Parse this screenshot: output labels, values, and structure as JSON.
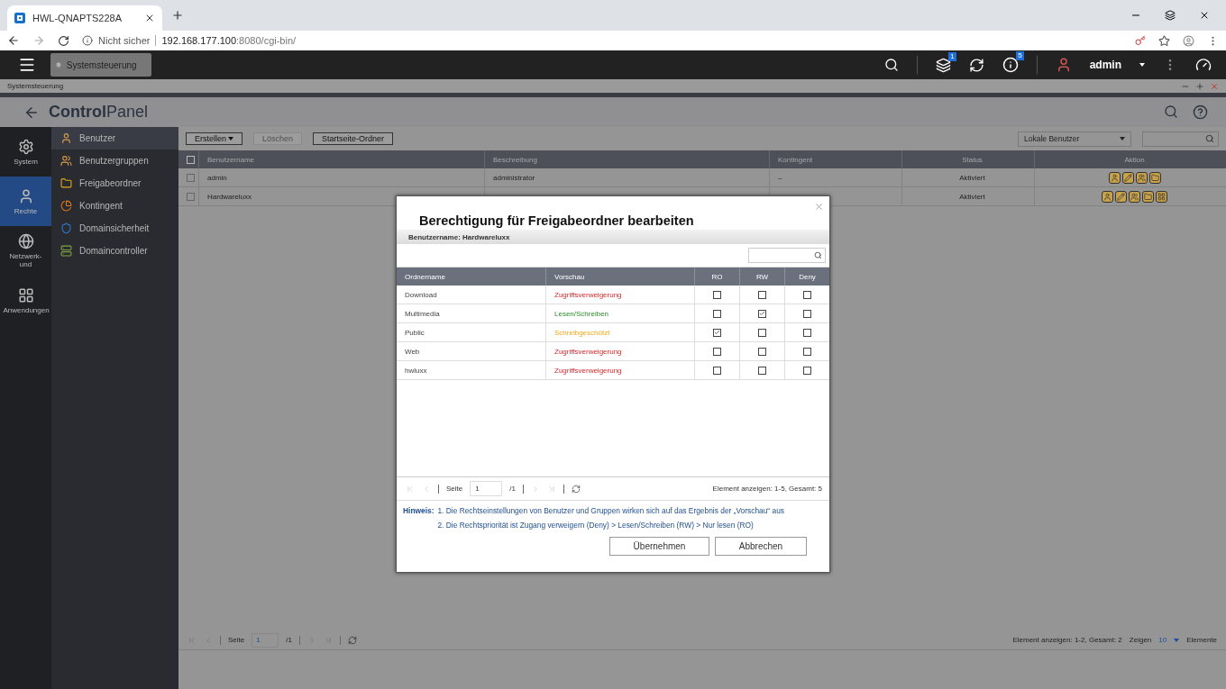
{
  "browser": {
    "tab_title": "HWL-QNAPTS228A",
    "security": "Nicht sicher",
    "host": "192.168.177.100",
    "path": ":8080/cgi-bin/"
  },
  "topbar": {
    "app_tab": "Systemsteuerung",
    "task_badge": "1",
    "info_badge": "5",
    "user": "admin"
  },
  "window_title": "Systemsteuerung",
  "header": {
    "title": "**Control**Panel"
  },
  "rail": [
    {
      "label": "System",
      "kind": "gear",
      "selected": false
    },
    {
      "label": "Rechte",
      "kind": "person",
      "selected": true
    },
    {
      "label": "Netzwerk- und",
      "kind": "globe",
      "selected": false
    },
    {
      "label": "Anwendungen",
      "kind": "apps",
      "selected": false
    }
  ],
  "submenu": [
    {
      "label": "Benutzer",
      "kind": "user",
      "selected": true
    },
    {
      "label": "Benutzergruppen",
      "kind": "group",
      "selected": false
    },
    {
      "label": "Freigabeordner",
      "kind": "folder",
      "selected": false
    },
    {
      "label": "Kontingent",
      "kind": "quota",
      "selected": false
    },
    {
      "label": "Domainsicherheit",
      "kind": "domain",
      "selected": false
    },
    {
      "label": "Domaincontroller",
      "kind": "controller",
      "selected": false
    }
  ],
  "toolbar": {
    "buttons": [
      {
        "label": "Erstellen",
        "dropdown": true,
        "disabled": false
      },
      {
        "label": "Löschen",
        "dropdown": false,
        "disabled": true
      },
      {
        "label": "Startseite-Ordner",
        "dropdown": false,
        "disabled": false
      }
    ],
    "filter": "Lokale Benutzer"
  },
  "table": {
    "columns": [
      "Benutzername",
      "Beschreibung",
      "Kontingent",
      "Status",
      "Aktion"
    ],
    "all_checked": false,
    "rows": [
      {
        "checked": false,
        "name": "admin",
        "description": "administrator",
        "quota": "–",
        "status": "Aktiviert",
        "actions": [
          {
            "kind": "info"
          },
          {
            "kind": "edit"
          },
          {
            "kind": "group"
          },
          {
            "kind": "folder"
          }
        ]
      },
      {
        "checked": false,
        "name": "Hardwareluxx",
        "status": "Aktiviert",
        "actions": [
          {
            "kind": "info"
          },
          {
            "kind": "edit"
          },
          {
            "kind": "group"
          },
          {
            "kind": "folder"
          },
          {
            "kind": "apps"
          }
        ]
      }
    ]
  },
  "pager": {
    "page_label": "Seite",
    "page": "1",
    "of": "/1",
    "summary": "Element anzeigen: 1-2, Gesamt: 2",
    "show_label": "Zeigen",
    "per_page": "10",
    "unit": "Elemente"
  },
  "dialog": {
    "title": "Berechtigung für Freigabeordner bearbeiten",
    "user_label": "Benutzername: Hardwareluxx",
    "columns": [
      "Ordnername",
      "Vorschau",
      "RO",
      "RW",
      "Deny"
    ],
    "rows": [
      {
        "name": "Download",
        "preview": "Zugriffsverweigerung",
        "kind": "deny",
        "ro": false,
        "rw": false,
        "deny": false
      },
      {
        "name": "Multimedia",
        "preview": "Lesen/Schreiben",
        "kind": "rw",
        "ro": false,
        "rw": true,
        "deny": false
      },
      {
        "name": "Public",
        "preview": "Schreibgeschützt",
        "kind": "ro",
        "ro": true,
        "rw": false,
        "deny": false
      },
      {
        "name": "Web",
        "preview": "Zugriffsverweigerung",
        "kind": "deny",
        "ro": false,
        "rw": false,
        "deny": false
      },
      {
        "name": "hwluxx",
        "preview": "Zugriffsverweigerung",
        "kind": "deny",
        "ro": false,
        "rw": false,
        "deny": false
      }
    ],
    "pager": {
      "page_label": "Seite",
      "page": "1",
      "of": "/1",
      "summary": "Element anzeigen: 1-5, Gesamt: 5"
    },
    "hint_label": "Hinweis:",
    "hints": [
      "1. Die Rechtseinstellungen von Benutzer und Gruppen wirken sich auf das Ergebnis der „Vorschau“ aus",
      "2. Die Rechtspriorität ist Zugang verweigern (Deny) > Lesen/Schreiben (RW) > Nur lesen (RO)"
    ],
    "buttons": [
      "Übernehmen",
      "Abbrechen"
    ]
  }
}
